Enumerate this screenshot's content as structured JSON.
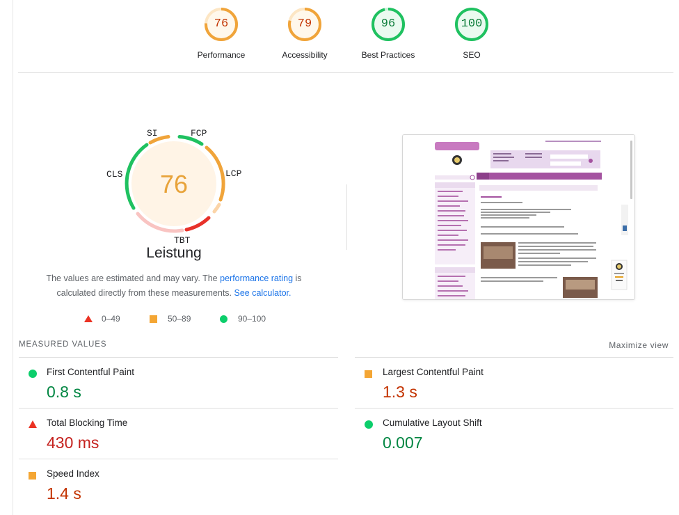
{
  "top_gauges": [
    {
      "score": "76",
      "label": "Performance",
      "status": "average"
    },
    {
      "score": "79",
      "label": "Accessibility",
      "status": "average"
    },
    {
      "score": "96",
      "label": "Best Practices",
      "status": "pass"
    },
    {
      "score": "100",
      "label": "SEO",
      "status": "pass"
    }
  ],
  "performance": {
    "score": "76",
    "title": "Leistung",
    "metric_labels": {
      "si": "SI",
      "fcp": "FCP",
      "lcp": "LCP",
      "tbt": "TBT",
      "cls": "CLS"
    },
    "description_1": "The values are estimated and may vary. The ",
    "rating_link": "performance rating",
    "description_2": " is calculated directly from these measurements. ",
    "calculator_link": "See calculator."
  },
  "legend": {
    "fail": "0–49",
    "average": "50–89",
    "pass": "90–100"
  },
  "measured": {
    "heading": "MEASURED VALUES",
    "maximize": "Maximize view",
    "metrics": [
      {
        "name": "First Contentful Paint",
        "value": "0.8 s",
        "status": "pass"
      },
      {
        "name": "Largest Contentful Paint",
        "value": "1.3 s",
        "status": "average"
      },
      {
        "name": "Total Blocking Time",
        "value": "430 ms",
        "status": "fail"
      },
      {
        "name": "Cumulative Layout Shift",
        "value": "0.007",
        "status": "pass"
      },
      {
        "name": "Speed Index",
        "value": "1.4 s",
        "status": "average"
      }
    ]
  },
  "colors": {
    "pass": "#0cce6b",
    "average": "#ffa400",
    "fail": "#ff4e42",
    "accent": "#1a73e8"
  }
}
